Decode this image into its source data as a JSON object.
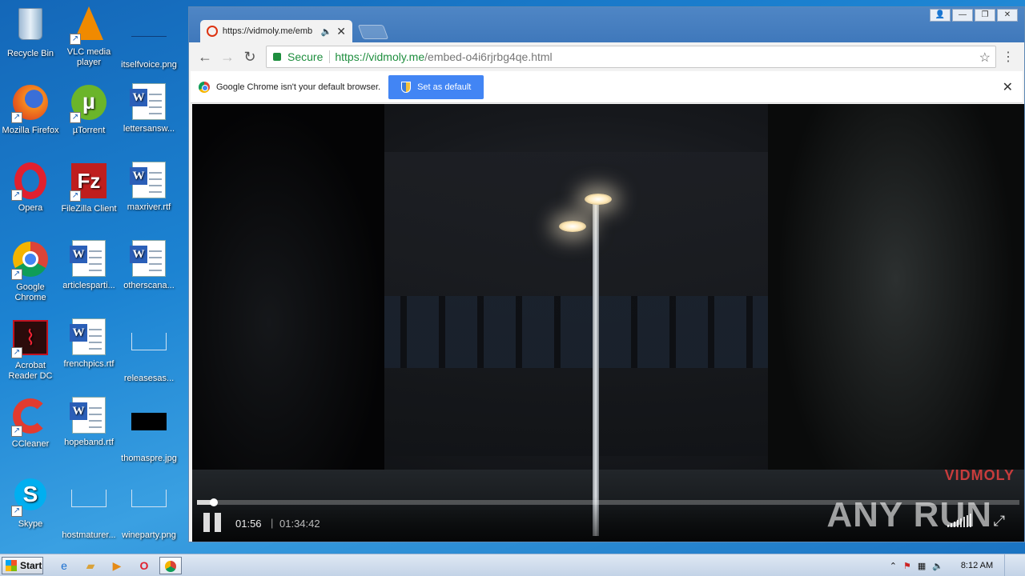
{
  "desktop": {
    "icons": [
      {
        "label": "Recycle Bin",
        "icon": "recycle-bin-icon"
      },
      {
        "label": "VLC media player",
        "icon": "vlc-icon"
      },
      {
        "label": "itselfvoice.png",
        "icon": "image-file-icon"
      },
      {
        "label": "Mozilla Firefox",
        "icon": "firefox-icon"
      },
      {
        "label": "µTorrent",
        "icon": "utorrent-icon"
      },
      {
        "label": "lettersansw...",
        "icon": "word-doc-icon"
      },
      {
        "label": "Opera",
        "icon": "opera-icon"
      },
      {
        "label": "FileZilla Client",
        "icon": "filezilla-icon"
      },
      {
        "label": "maxriver.rtf",
        "icon": "word-doc-icon"
      },
      {
        "label": "Google Chrome",
        "icon": "chrome-icon"
      },
      {
        "label": "articlesparti...",
        "icon": "word-doc-icon"
      },
      {
        "label": "otherscana...",
        "icon": "word-doc-icon"
      },
      {
        "label": "Acrobat Reader DC",
        "icon": "acrobat-icon"
      },
      {
        "label": "frenchpics.rtf",
        "icon": "word-doc-icon"
      },
      {
        "label": "releasesas...",
        "icon": "image-file-icon"
      },
      {
        "label": "CCleaner",
        "icon": "ccleaner-icon"
      },
      {
        "label": "hopeband.rtf",
        "icon": "word-doc-icon"
      },
      {
        "label": "thomaspre.jpg",
        "icon": "image-file-icon"
      },
      {
        "label": "Skype",
        "icon": "skype-icon"
      },
      {
        "label": "hostmaturer...",
        "icon": "image-file-icon"
      },
      {
        "label": "wineparty.png",
        "icon": "image-file-icon"
      }
    ]
  },
  "browser": {
    "tab": {
      "title": "https://vidmoly.me/emb",
      "audio_icon": "speaker-icon"
    },
    "toolbar": {
      "secure_label": "Secure",
      "url_host": "https://vidmoly.me",
      "url_path": "/embed-o4i6rjrbg4qe.html"
    },
    "infobar": {
      "message": "Google Chrome isn't your default browser.",
      "button": "Set as default"
    },
    "player": {
      "current_time": "01:56",
      "separator": "|",
      "duration": "01:34:42",
      "progress": 0.02,
      "watermark": "VIDMOLY",
      "overlay_watermark": "ANY RUN",
      "accent": "#c83c3c"
    }
  },
  "taskbar": {
    "start_label": "Start",
    "clock": "8:12 AM"
  }
}
